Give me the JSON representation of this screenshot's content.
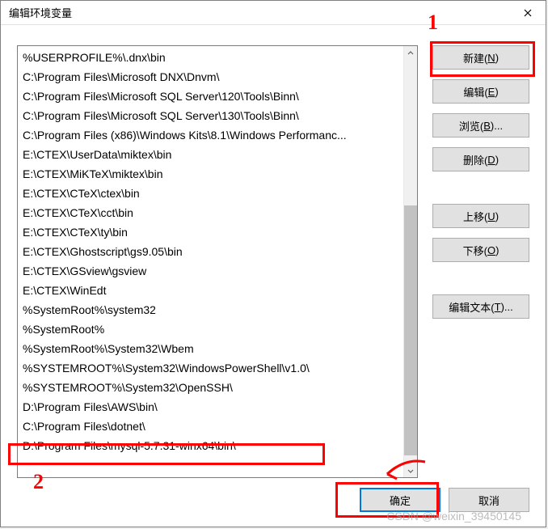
{
  "dialog": {
    "title": "编辑环境变量"
  },
  "list": {
    "items": [
      "%USERPROFILE%\\.dnx\\bin",
      "C:\\Program Files\\Microsoft DNX\\Dnvm\\",
      "C:\\Program Files\\Microsoft SQL Server\\120\\Tools\\Binn\\",
      "C:\\Program Files\\Microsoft SQL Server\\130\\Tools\\Binn\\",
      "C:\\Program Files (x86)\\Windows Kits\\8.1\\Windows Performanc...",
      "E:\\CTEX\\UserData\\miktex\\bin",
      "E:\\CTEX\\MiKTeX\\miktex\\bin",
      "E:\\CTEX\\CTeX\\ctex\\bin",
      "E:\\CTEX\\CTeX\\cct\\bin",
      "E:\\CTEX\\CTeX\\ty\\bin",
      "E:\\CTEX\\Ghostscript\\gs9.05\\bin",
      "E:\\CTEX\\GSview\\gsview",
      "E:\\CTEX\\WinEdt",
      "%SystemRoot%\\system32",
      "%SystemRoot%",
      "%SystemRoot%\\System32\\Wbem",
      "%SYSTEMROOT%\\System32\\WindowsPowerShell\\v1.0\\",
      "%SYSTEMROOT%\\System32\\OpenSSH\\",
      "D:\\Program Files\\AWS\\bin\\",
      "C:\\Program Files\\dotnet\\",
      "D:\\Program Files\\mysql-5.7.31-winx64\\bin\\"
    ]
  },
  "buttons": {
    "new": {
      "prefix": "新建(",
      "key": "N",
      "suffix": ")"
    },
    "edit": {
      "prefix": "编辑(",
      "key": "E",
      "suffix": ")"
    },
    "browse": {
      "prefix": "浏览(",
      "key": "B",
      "suffix": ")..."
    },
    "delete": {
      "prefix": "删除(",
      "key": "D",
      "suffix": ")"
    },
    "moveup": {
      "prefix": "上移(",
      "key": "U",
      "suffix": ")"
    },
    "movedown": {
      "prefix": "下移(",
      "key": "O",
      "suffix": ")"
    },
    "edittext": {
      "prefix": "编辑文本(",
      "key": "T",
      "suffix": ")..."
    },
    "ok": "确定",
    "cancel": "取消"
  },
  "annotations": {
    "mark1": "1",
    "mark2": "2",
    "watermark": "CSDN @weixin_39450145"
  }
}
